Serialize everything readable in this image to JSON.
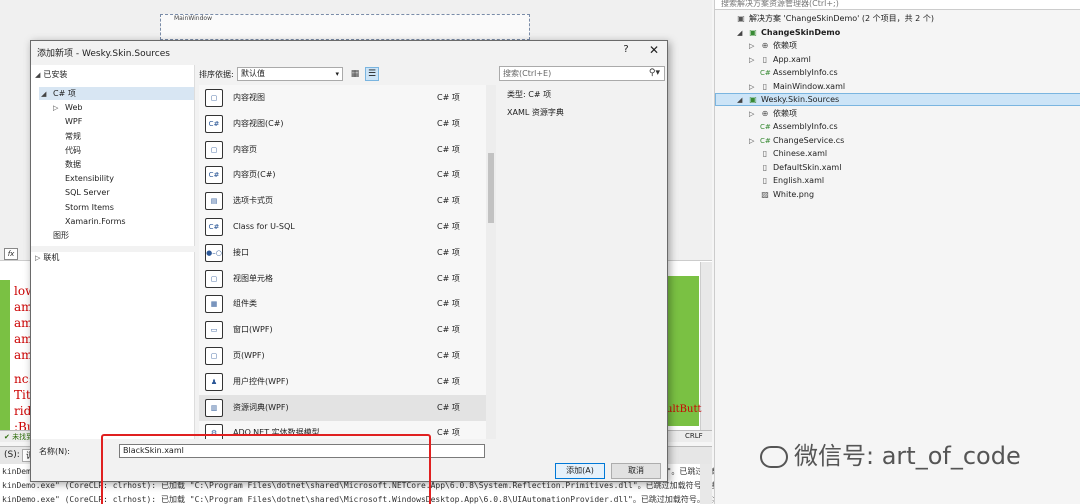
{
  "background": {
    "main_window_title": "MainWindow",
    "code_lines": [
      "low",
      "aml",
      "aml",
      "aml",
      "aml",
      "nc:",
      "Titl",
      "rid",
      ":Bu"
    ],
    "status_no_issues": "✔ 未找到",
    "status_crlf": "CRLF",
    "default_button_fragment": "ultButt",
    "output_source": "(S):",
    "output_dropdown_label": "调试",
    "output_lines": [
      "kinDemo.exe\" (CoreCLR: clrhost): 已加载 \"C:\\Program Files\\dotnet\\shared\\Microsoft.NETCore.App\\6.0.8\\System.Reflection.Emit.ILGeneration.dll\"。已跳过加载符号。模块进行了优化",
      "kinDemo.exe\" (CoreCLR: clrhost): 已加载 \"C:\\Program Files\\dotnet\\shared\\Microsoft.NETCore.App\\6.0.8\\System.Reflection.Primitives.dll\"。已跳过加载符号。模块进行了优化，并且调",
      "kinDemo.exe\" (CoreCLR: clrhost): 已加载 \"C:\\Program Files\\dotnet\\shared\\Microsoft.WindowsDesktop.App\\6.0.8\\UIAutomationProvider.dll\"。已跳过加载符号。模块进行了优化，并且调"
    ]
  },
  "solution_explorer": {
    "search_placeholder": "搜索解决方案资源管理器(Ctrl+;)",
    "items": [
      {
        "label": "解决方案 'ChangeSkinDemo' (2 个项目，共 2 个)",
        "icon": "solution-icon",
        "indent": 0,
        "bold": false,
        "arrow": ""
      },
      {
        "label": "ChangeSkinDemo",
        "icon": "csharp-project-icon",
        "indent": 1,
        "bold": true,
        "arrow": "◢"
      },
      {
        "label": "依赖项",
        "icon": "dependencies-icon",
        "indent": 2,
        "bold": false,
        "arrow": "▷"
      },
      {
        "label": "App.xaml",
        "icon": "xaml-file-icon",
        "indent": 2,
        "bold": false,
        "arrow": "▷"
      },
      {
        "label": "AssemblyInfo.cs",
        "icon": "csharp-file-icon",
        "indent": 2,
        "bold": false,
        "arrow": ""
      },
      {
        "label": "MainWindow.xaml",
        "icon": "xaml-file-icon",
        "indent": 2,
        "bold": false,
        "arrow": "▷"
      },
      {
        "label": "Wesky.Skin.Sources",
        "icon": "csharp-project-icon",
        "indent": 1,
        "bold": false,
        "arrow": "◢"
      },
      {
        "label": "依赖项",
        "icon": "dependencies-icon",
        "indent": 2,
        "bold": false,
        "arrow": "▷"
      },
      {
        "label": "AssemblyInfo.cs",
        "icon": "csharp-file-icon",
        "indent": 2,
        "bold": false,
        "arrow": ""
      },
      {
        "label": "ChangeService.cs",
        "icon": "csharp-file-icon",
        "indent": 2,
        "bold": false,
        "arrow": "▷"
      },
      {
        "label": "Chinese.xaml",
        "icon": "xaml-file-icon",
        "indent": 2,
        "bold": false,
        "arrow": ""
      },
      {
        "label": "DefaultSkin.xaml",
        "icon": "xaml-file-icon",
        "indent": 2,
        "bold": false,
        "arrow": ""
      },
      {
        "label": "English.xaml",
        "icon": "xaml-file-icon",
        "indent": 2,
        "bold": false,
        "arrow": ""
      },
      {
        "label": "White.png",
        "icon": "image-file-icon",
        "indent": 2,
        "bold": false,
        "arrow": ""
      }
    ]
  },
  "watermark": {
    "text": "微信号: art_of_code"
  },
  "dialog": {
    "title": "添加新项 - Wesky.Skin.Sources",
    "help_label": "?",
    "close_label": "✕",
    "installed_label": "已安装",
    "tree": [
      {
        "label": "C# 项",
        "indent": 1,
        "arrow": "◢"
      },
      {
        "label": "Web",
        "indent": 2,
        "arrow": "▷"
      },
      {
        "label": "WPF",
        "indent": 2,
        "arrow": ""
      },
      {
        "label": "常规",
        "indent": 2,
        "arrow": ""
      },
      {
        "label": "代码",
        "indent": 2,
        "arrow": ""
      },
      {
        "label": "数据",
        "indent": 2,
        "arrow": ""
      },
      {
        "label": "Extensibility",
        "indent": 2,
        "arrow": ""
      },
      {
        "label": "SQL Server",
        "indent": 2,
        "arrow": ""
      },
      {
        "label": "Storm Items",
        "indent": 2,
        "arrow": ""
      },
      {
        "label": "Xamarin.Forms",
        "indent": 2,
        "arrow": ""
      },
      {
        "label": "图形",
        "indent": 1,
        "arrow": ""
      }
    ],
    "online_label": "联机",
    "sort_label": "排序依据:",
    "sort_value": "默认值",
    "search_placeholder": "搜索(Ctrl+E)",
    "templates": [
      {
        "name": "内容视图",
        "lang": "C# 项",
        "icon": "content-view-icon"
      },
      {
        "name": "内容视图(C#)",
        "lang": "C# 项",
        "icon": "content-view-csharp-icon"
      },
      {
        "name": "内容页",
        "lang": "C# 项",
        "icon": "content-page-icon"
      },
      {
        "name": "内容页(C#)",
        "lang": "C# 项",
        "icon": "content-page-csharp-icon"
      },
      {
        "name": "选项卡式页",
        "lang": "C# 项",
        "icon": "tabbed-page-icon"
      },
      {
        "name": "Class for U-SQL",
        "lang": "C# 项",
        "icon": "usql-class-icon"
      },
      {
        "name": "接口",
        "lang": "C# 项",
        "icon": "interface-icon"
      },
      {
        "name": "视图单元格",
        "lang": "C# 项",
        "icon": "view-cell-icon"
      },
      {
        "name": "组件类",
        "lang": "C# 项",
        "icon": "component-class-icon"
      },
      {
        "name": "窗口(WPF)",
        "lang": "C# 项",
        "icon": "window-wpf-icon"
      },
      {
        "name": "页(WPF)",
        "lang": "C# 项",
        "icon": "page-wpf-icon"
      },
      {
        "name": "用户控件(WPF)",
        "lang": "C# 项",
        "icon": "user-control-icon"
      },
      {
        "name": "资源词典(WPF)",
        "lang": "C# 项",
        "icon": "resource-dictionary-icon"
      },
      {
        "name": "ADO.NET 实体数据模型",
        "lang": "C# 项",
        "icon": "ado-net-model-icon"
      }
    ],
    "selected_template_index": 12,
    "type_label": "类型:  C# 项",
    "type_description": "XAML 资源字典",
    "name_label": "名称(N):",
    "name_value": "BlackSkin.xaml",
    "add_button": "添加(A)",
    "cancel_button": "取消"
  },
  "colors": {
    "accent": "#0078d7",
    "highlight_box": "#e02020",
    "code_green": "#7ac143"
  }
}
